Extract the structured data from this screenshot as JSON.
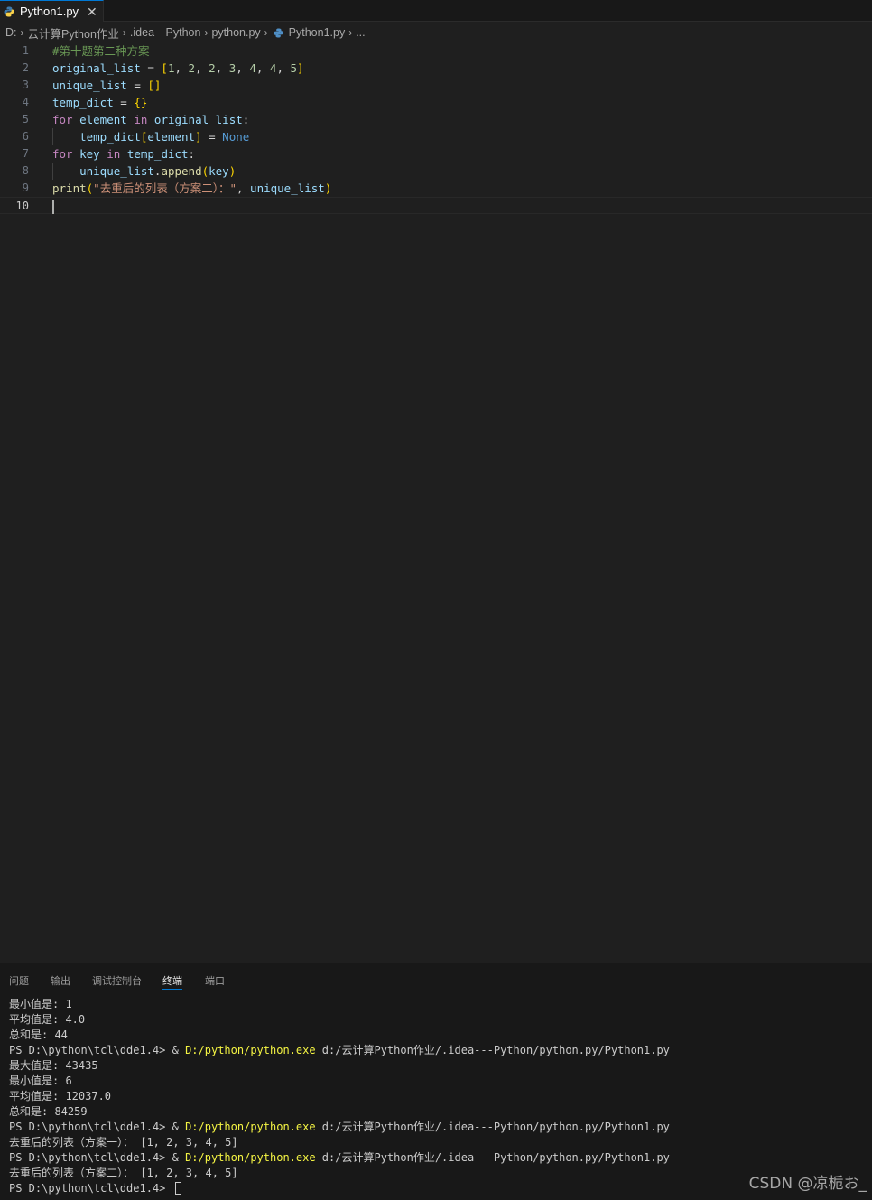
{
  "tab": {
    "label": "Python1.py",
    "close_glyph": "✕",
    "icon": "python-file-icon"
  },
  "breadcrumb": [
    "D:",
    "云计算Python作业",
    ".idea---Python",
    "python.py",
    "Python1.py",
    "..."
  ],
  "editor": {
    "line_numbers": [
      "1",
      "2",
      "3",
      "4",
      "5",
      "6",
      "7",
      "8",
      "9",
      "10"
    ],
    "active_line": "10",
    "lines": [
      [
        {
          "t": "#第十题第二种方案",
          "c": "cm"
        }
      ],
      [
        {
          "t": "original_list",
          "c": "va"
        },
        {
          "t": " = ",
          "c": "op"
        },
        {
          "t": "[",
          "c": "br1"
        },
        {
          "t": "1",
          "c": "nu"
        },
        {
          "t": ", ",
          "c": "op"
        },
        {
          "t": "2",
          "c": "nu"
        },
        {
          "t": ", ",
          "c": "op"
        },
        {
          "t": "2",
          "c": "nu"
        },
        {
          "t": ", ",
          "c": "op"
        },
        {
          "t": "3",
          "c": "nu"
        },
        {
          "t": ", ",
          "c": "op"
        },
        {
          "t": "4",
          "c": "nu"
        },
        {
          "t": ", ",
          "c": "op"
        },
        {
          "t": "4",
          "c": "nu"
        },
        {
          "t": ", ",
          "c": "op"
        },
        {
          "t": "5",
          "c": "nu"
        },
        {
          "t": "]",
          "c": "br1"
        }
      ],
      [
        {
          "t": "unique_list",
          "c": "va"
        },
        {
          "t": " = ",
          "c": "op"
        },
        {
          "t": "[]",
          "c": "br1"
        }
      ],
      [
        {
          "t": "temp_dict",
          "c": "va"
        },
        {
          "t": " = ",
          "c": "op"
        },
        {
          "t": "{}",
          "c": "br1"
        }
      ],
      [
        {
          "t": "for",
          "c": "kw"
        },
        {
          "t": " ",
          "c": "op"
        },
        {
          "t": "element",
          "c": "va"
        },
        {
          "t": " ",
          "c": "op"
        },
        {
          "t": "in",
          "c": "kw"
        },
        {
          "t": " ",
          "c": "op"
        },
        {
          "t": "original_list",
          "c": "va"
        },
        {
          "t": ":",
          "c": "op"
        }
      ],
      [
        {
          "t": "    ",
          "c": "op"
        },
        {
          "t": "temp_dict",
          "c": "va"
        },
        {
          "t": "[",
          "c": "br1"
        },
        {
          "t": "element",
          "c": "va"
        },
        {
          "t": "]",
          "c": "br1"
        },
        {
          "t": " = ",
          "c": "op"
        },
        {
          "t": "None",
          "c": "kc"
        }
      ],
      [
        {
          "t": "for",
          "c": "kw"
        },
        {
          "t": " ",
          "c": "op"
        },
        {
          "t": "key",
          "c": "va"
        },
        {
          "t": " ",
          "c": "op"
        },
        {
          "t": "in",
          "c": "kw"
        },
        {
          "t": " ",
          "c": "op"
        },
        {
          "t": "temp_dict",
          "c": "va"
        },
        {
          "t": ":",
          "c": "op"
        }
      ],
      [
        {
          "t": "    ",
          "c": "op"
        },
        {
          "t": "unique_list",
          "c": "va"
        },
        {
          "t": ".",
          "c": "op"
        },
        {
          "t": "append",
          "c": "fn"
        },
        {
          "t": "(",
          "c": "br1"
        },
        {
          "t": "key",
          "c": "va"
        },
        {
          "t": ")",
          "c": "br1"
        }
      ],
      [
        {
          "t": "print",
          "c": "fn"
        },
        {
          "t": "(",
          "c": "br1"
        },
        {
          "t": "\"去重后的列表（方案二）：\"",
          "c": "st"
        },
        {
          "t": ", ",
          "c": "op"
        },
        {
          "t": "unique_list",
          "c": "va"
        },
        {
          "t": ")",
          "c": "br1"
        }
      ],
      []
    ]
  },
  "panel": {
    "tabs": [
      "问题",
      "输出",
      "调试控制台",
      "终端",
      "端口"
    ],
    "active_tab": "终端"
  },
  "terminal": {
    "lines": [
      [
        {
          "t": "最小值是: 1"
        }
      ],
      [
        {
          "t": "平均值是: 4.0"
        }
      ],
      [
        {
          "t": "总和是: 44"
        }
      ],
      [
        {
          "t": "PS D:\\python\\tcl\\dde1.4> & "
        },
        {
          "t": "D:/python/python.exe",
          "c": "yl"
        },
        {
          "t": " d:/云计算Python作业/.idea---Python/python.py/Python1.py"
        }
      ],
      [
        {
          "t": "最大值是: 43435"
        }
      ],
      [
        {
          "t": "最小值是: 6"
        }
      ],
      [
        {
          "t": "平均值是: 12037.0"
        }
      ],
      [
        {
          "t": "总和是: 84259"
        }
      ],
      [
        {
          "t": "PS D:\\python\\tcl\\dde1.4> & "
        },
        {
          "t": "D:/python/python.exe",
          "c": "yl"
        },
        {
          "t": " d:/云计算Python作业/.idea---Python/python.py/Python1.py"
        }
      ],
      [
        {
          "t": "去重后的列表（方案一）： [1, 2, 3, 4, 5]"
        }
      ],
      [
        {
          "t": "PS D:\\python\\tcl\\dde1.4> & "
        },
        {
          "t": "D:/python/python.exe",
          "c": "yl"
        },
        {
          "t": " d:/云计算Python作业/.idea---Python/python.py/Python1.py"
        }
      ],
      [
        {
          "t": "去重后的列表（方案二）： [1, 2, 3, 4, 5]"
        }
      ],
      [
        {
          "t": "PS D:\\python\\tcl\\dde1.4> "
        }
      ]
    ]
  },
  "watermark": "CSDN @凉栀お_",
  "colors": {
    "accent": "#0078d4",
    "editor_bg": "#1f1f1f",
    "panel_bg": "#181818"
  }
}
